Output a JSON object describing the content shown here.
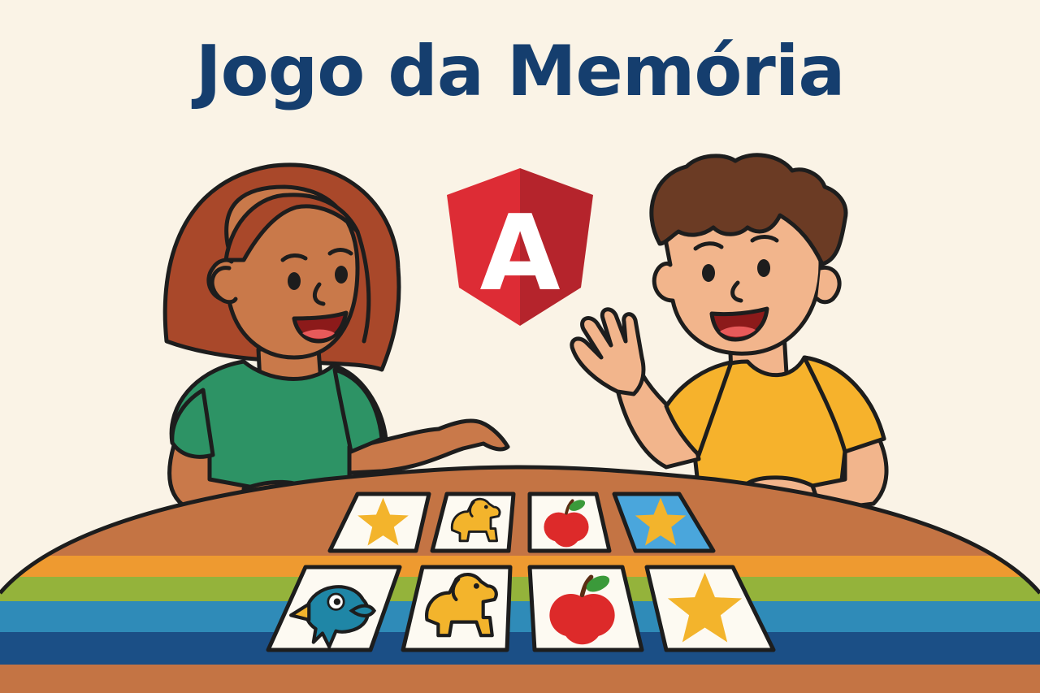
{
  "game": {
    "title": "Jogo da Memória",
    "logo": {
      "name": "angular-logo",
      "letter": "A",
      "color": "#dd2c35",
      "color_dark": "#b5242c"
    },
    "players": [
      {
        "name": "girl-player",
        "shirt_color": "#2d9365",
        "hair_color": "#a9482a",
        "skin_color": "#c9794a"
      },
      {
        "name": "boy-player",
        "shirt_color": "#f6b22c",
        "hair_color": "#6b3b24",
        "skin_color": "#f2b58c"
      }
    ],
    "table": {
      "top_color": "#c47444",
      "stripes": [
        "#ee9a30",
        "#94b33b",
        "#2f8bb8",
        "#1b4f86",
        "#c47444"
      ]
    },
    "cards": [
      {
        "row": 1,
        "symbol": "star",
        "face_up": true,
        "highlighted": false
      },
      {
        "row": 1,
        "symbol": "dog",
        "face_up": true,
        "highlighted": false
      },
      {
        "row": 1,
        "symbol": "apple",
        "face_up": true,
        "highlighted": false
      },
      {
        "row": 1,
        "symbol": "star",
        "face_up": true,
        "highlighted": true
      },
      {
        "row": 2,
        "symbol": "fish",
        "face_up": true,
        "highlighted": false
      },
      {
        "row": 2,
        "symbol": "dog",
        "face_up": true,
        "highlighted": false
      },
      {
        "row": 2,
        "symbol": "apple",
        "face_up": true,
        "highlighted": false
      },
      {
        "row": 2,
        "symbol": "star",
        "face_up": true,
        "highlighted": false
      }
    ]
  }
}
